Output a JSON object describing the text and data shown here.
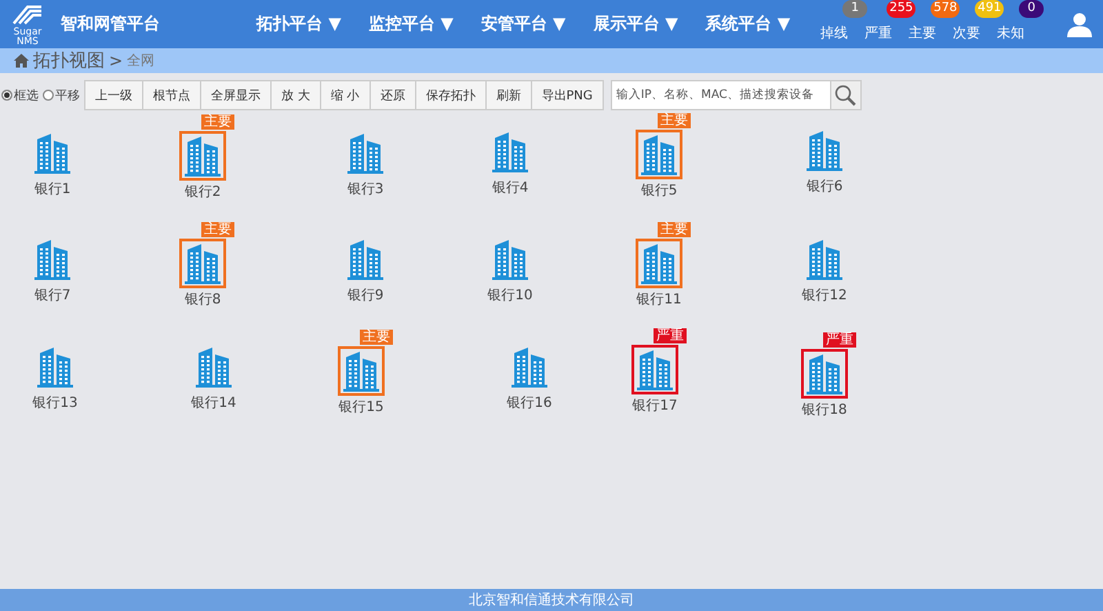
{
  "brand": {
    "logo_lines": [
      "Sugar",
      "NMS"
    ],
    "title": "智和网管平台"
  },
  "nav": [
    {
      "label": "拓扑平台",
      "caret": "▼"
    },
    {
      "label": "监控平台",
      "caret": "▼"
    },
    {
      "label": "安管平台",
      "caret": "▼"
    },
    {
      "label": "展示平台",
      "caret": "▼"
    },
    {
      "label": "系统平台",
      "caret": "▼"
    }
  ],
  "alarms": [
    {
      "label": "掉线",
      "count": "1",
      "color": "#777777"
    },
    {
      "label": "严重",
      "count": "255",
      "color": "#e8101c"
    },
    {
      "label": "主要",
      "count": "578",
      "color": "#f26a10"
    },
    {
      "label": "次要",
      "count": "491",
      "color": "#f0c010"
    },
    {
      "label": "未知",
      "count": "0",
      "color": "#3b0a78"
    }
  ],
  "breadcrumb": {
    "title": "拓扑视图",
    "separator": ">",
    "current": "全网"
  },
  "modes": [
    {
      "label": "框选",
      "selected": true
    },
    {
      "label": "平移",
      "selected": false
    }
  ],
  "toolbar": [
    "上一级",
    "根节点",
    "全屏显示",
    "放 大",
    "缩 小",
    "还原",
    "保存拓扑",
    "刷新",
    "导出PNG"
  ],
  "search": {
    "placeholder": "输入IP、名称、MAC、描述搜索设备"
  },
  "nodes": [
    {
      "label": "银行1",
      "kind": "normal"
    },
    {
      "label": "银行2",
      "kind": "major",
      "tag": "主要"
    },
    {
      "label": "银行3",
      "kind": "normal"
    },
    {
      "label": "银行4",
      "kind": "normal"
    },
    {
      "label": "银行5",
      "kind": "major",
      "tag": "主要"
    },
    {
      "label": "银行6",
      "kind": "normal"
    },
    {
      "label": "银行7",
      "kind": "normal"
    },
    {
      "label": "银行8",
      "kind": "major",
      "tag": "主要"
    },
    {
      "label": "银行9",
      "kind": "normal"
    },
    {
      "label": "银行10",
      "kind": "normal"
    },
    {
      "label": "银行11",
      "kind": "major",
      "tag": "主要"
    },
    {
      "label": "银行12",
      "kind": "normal"
    },
    {
      "label": "银行13",
      "kind": "normal"
    },
    {
      "label": "银行14",
      "kind": "normal"
    },
    {
      "label": "银行15",
      "kind": "major",
      "tag": "主要"
    },
    {
      "label": "银行16",
      "kind": "normal"
    },
    {
      "label": "银行17",
      "kind": "critical",
      "tag": "严重"
    },
    {
      "label": "银行18",
      "kind": "critical",
      "tag": "严重"
    }
  ],
  "footer": "北京智和信通技术有限公司"
}
